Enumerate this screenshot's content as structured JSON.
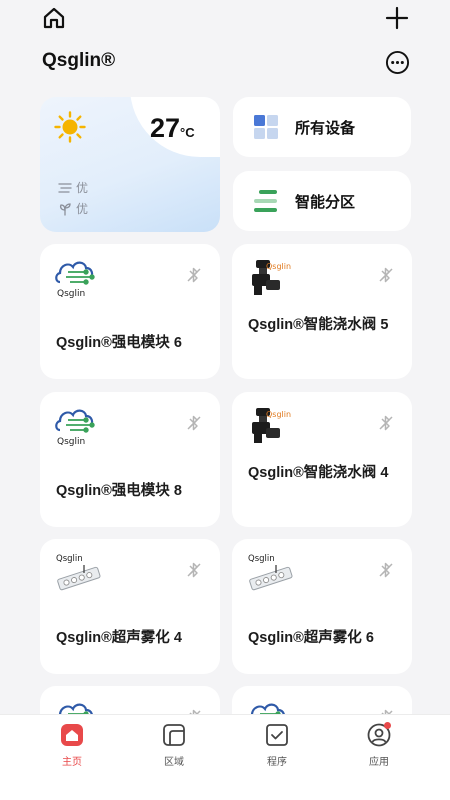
{
  "header": {
    "brand": "Qsglin®"
  },
  "weather": {
    "temperature": "27",
    "unit": "°C",
    "humidity_level": "优",
    "air_level": "优"
  },
  "quick": {
    "all_devices": "所有设备",
    "smart_zones": "智能分区"
  },
  "devices": [
    {
      "name": "Qsglin®强电模块 6",
      "logo_text": "Qsglin"
    },
    {
      "name": "Qsglin®智能浇水阀 5",
      "logo_text": "Qsglin"
    },
    {
      "name": "Qsglin®强电模块 8",
      "logo_text": "Qsglin"
    },
    {
      "name": "Qsglin®智能浇水阀 4",
      "logo_text": "Qsglin"
    },
    {
      "name": "Qsglin®超声雾化 4",
      "logo_text": "Qsglin"
    },
    {
      "name": "Qsglin®超声雾化 6",
      "logo_text": "Qsglin"
    }
  ],
  "tabs": [
    {
      "label": "主页",
      "icon": "home-icon",
      "active": true
    },
    {
      "label": "区域",
      "icon": "area-icon"
    },
    {
      "label": "程序",
      "icon": "program-icon"
    },
    {
      "label": "应用",
      "icon": "user-icon",
      "badge": true
    }
  ],
  "colors": {
    "accent": "#e8494a",
    "green": "#3aa25a",
    "blue": "#4a78d6"
  }
}
